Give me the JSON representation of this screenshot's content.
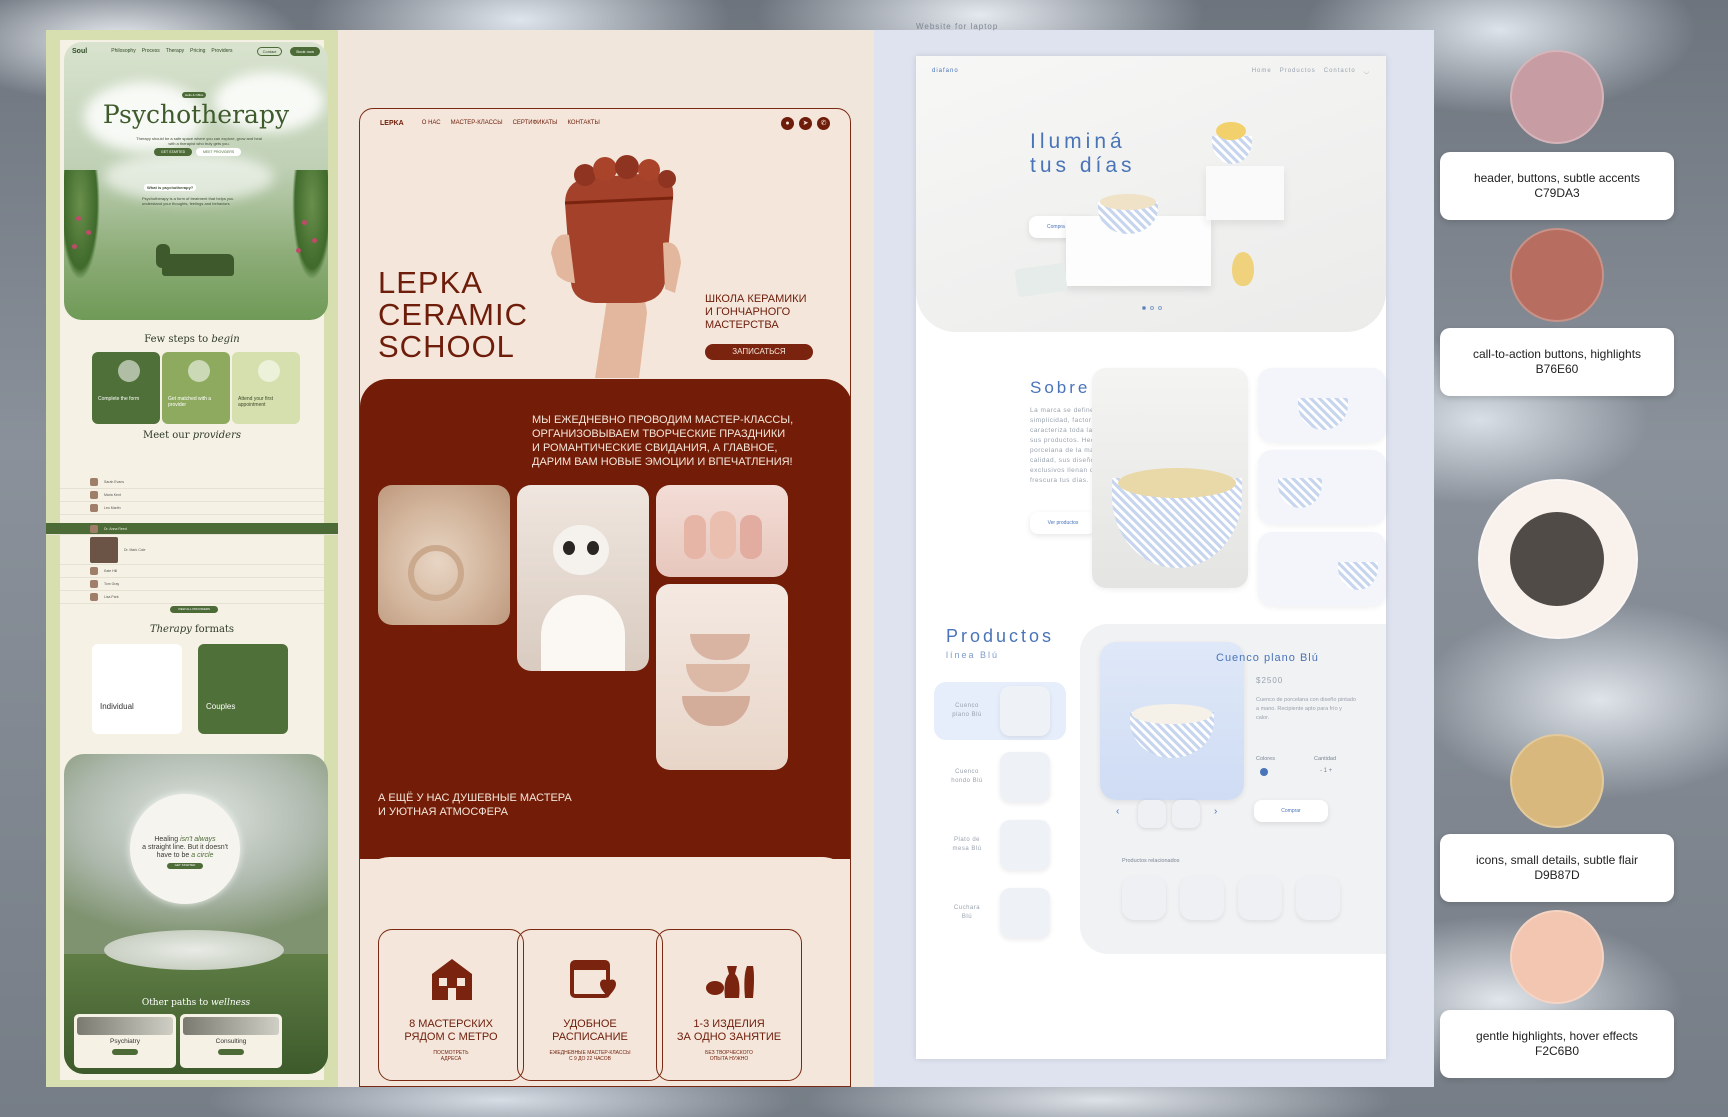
{
  "psych": {
    "logo": "Soul",
    "nav": [
      "Philosophy",
      "Process",
      "Therapy",
      "Pricing",
      "Providers"
    ],
    "nav_login": "Contact",
    "nav_cta": "Book now",
    "badge": "Hello & Office",
    "title": "Psychotherapy",
    "subtitle": "Therapy should be a safe space where you can explore, grow and heal with a therapist who truly gets you.",
    "hero_btn_primary": "GET STARTED",
    "hero_btn_secondary": "MEET PROVIDERS",
    "what_heading": "What is psychotherapy?",
    "what_text": "Psychotherapy is a form of treatment that helps you understand your thoughts, feelings and behaviors",
    "steps_title": "Few steps to",
    "steps_title_em": "begin",
    "steps": [
      "Complete the form",
      "Get matched with a provider",
      "Attend your first appointment"
    ],
    "providers_title": "Meet our",
    "providers_title_em": "providers",
    "providers": [
      "Sarah Evans",
      "Maria Kent",
      "Leo Martin",
      "Dr. Anna Reed",
      "Dr. Mark Cole",
      "Kate Hill",
      "Tom Gray",
      "Lisa Park"
    ],
    "providers_btn": "VIEW ALL PROVIDERS",
    "formats_title": "Therapy",
    "formats_title_em": "formats",
    "formats": [
      "Individual",
      "Couples"
    ],
    "healing_1": "Healing",
    "healing_em1": "isn't always",
    "healing_2": "a straight line. But it doesn't",
    "healing_3": "have to be",
    "healing_em2": "a circle",
    "healing_btn": "GET STARTED",
    "paths_title": "Other paths to",
    "paths_title_em": "wellness",
    "paths": [
      "Psychiatry",
      "Consulting"
    ]
  },
  "lepka": {
    "nav_logo": "LEPKA",
    "nav": [
      "О НАС",
      "МАСТЕР-КЛАССЫ",
      "СЕРТИФИКАТЫ",
      "КОНТАКТЫ"
    ],
    "title_lines": [
      "LEPKA",
      "CERAMIC",
      "SCHOOL"
    ],
    "sub_lines": [
      "ШКОЛА КЕРАМИКИ",
      "И ГОНЧАРНОГО",
      "МАСТЕРСТВА"
    ],
    "signup": "ЗАПИСАТЬСЯ",
    "intro_lines": [
      "МЫ ЕЖЕДНЕВНО ПРОВОДИМ МАСТЕР-КЛАССЫ,",
      "ОРГАНИЗОВЫВАЕМ ТВОРЧЕСКИЕ ПРАЗДНИКИ",
      "И РОМАНТИЧЕСКИЕ СВИДАНИЯ, А ГЛАВНОЕ,",
      "ДАРИМ ВАМ НОВЫЕ ЭМОЦИИ И ВПЕЧАТЛЕНИЯ!"
    ],
    "outro_lines": [
      "А ЕЩЁ У НАС ДУШЕВНЫЕ МАСТЕРА",
      "И УЮТНАЯ АТМОСФЕРА"
    ],
    "features": [
      {
        "h1": "8 МАСТЕРСКИХ",
        "h2": "РЯДОМ С МЕТРО",
        "s1": "ПОСМОТРЕТЬ",
        "s2": "АДРЕСА",
        "icon": "house-icon"
      },
      {
        "h1": "УДОБНОЕ",
        "h2": "РАСПИСАНИЕ",
        "s1": "ЕЖЕДНЕВНЫЕ МАСТЕР-КЛАССЫ",
        "s2": "С 9 ДО 22 ЧАСОВ",
        "icon": "calendar-heart-icon"
      },
      {
        "h1": "1-3 ИЗДЕЛИЯ",
        "h2": "ЗА ОДНО ЗАНЯТИЕ",
        "s1": "БЕЗ ТВОРЧЕСКОГО",
        "s2": "ОПЫТА НУЖНО",
        "icon": "vases-icon"
      }
    ]
  },
  "diafano": {
    "caption": "Website for laptop",
    "logo": "diafano",
    "nav": [
      "Home",
      "Productos",
      "Contacto"
    ],
    "hero_lines": [
      "Iluminá",
      "tus días"
    ],
    "hero_cta": "Compra ahora",
    "about_title": "Sobre nosotros",
    "about_text": "La marca se define por la simplicidad, factor que caracteriza toda la línea de sus productos. Hechos de porcelana de la más alta calidad, sus diseños exclusivos llenan de luz y frescura tus días.",
    "about_btn": "Ver productos",
    "products_title": "Productos",
    "products_sub": "línea Blú",
    "product_list": [
      {
        "l1": "Cuenco",
        "l2": "plano Blú"
      },
      {
        "l1": "Cuenco",
        "l2": "hondo Blú"
      },
      {
        "l1": "Plato de",
        "l2": "mesa Blú"
      },
      {
        "l1": "Cuchara",
        "l2": "Blú"
      }
    ],
    "selected_name": "Cuenco plano Blú",
    "price": "$2500",
    "desc": "Cuenco de porcelana con diseño pintado a mano. Recipiente apto para frío y calor.",
    "colors_label": "Colores",
    "qty_label": "Cantidad",
    "qty_value": "- 1 +",
    "buy": "Comprar",
    "related": "Productos relacionados"
  },
  "palette": [
    {
      "hex": "#C79DA3",
      "label": "header, buttons, subtle accents",
      "code": "C79DA3"
    },
    {
      "hex": "#B76E60",
      "label": "call-to-action buttons, highlights",
      "code": "B76E60"
    },
    {
      "hex": "#514B48",
      "label": "",
      "code": ""
    },
    {
      "hex": "#D9B87D",
      "label": "icons, small details, subtle flair",
      "code": "D9B87D"
    },
    {
      "hex": "#F2C6B0",
      "label": "gentle highlights, hover effects",
      "code": "F2C6B0"
    }
  ]
}
